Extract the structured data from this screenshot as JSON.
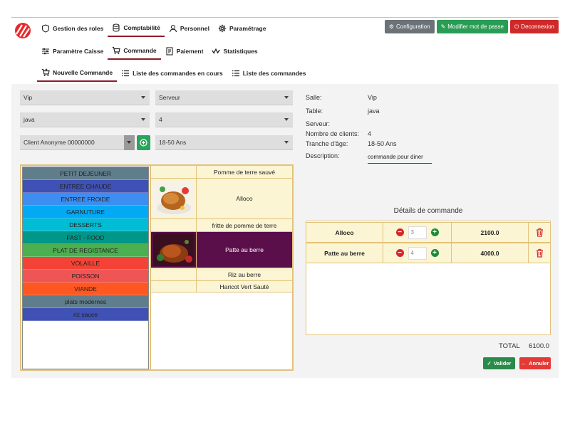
{
  "nav": {
    "main": [
      {
        "label": "Gestion des roles",
        "icon": "shield-icon"
      },
      {
        "label": "Comptabilité",
        "icon": "database-icon"
      },
      {
        "label": "Personnel",
        "icon": "user-icon"
      },
      {
        "label": "Paramétrage",
        "icon": "gear-icon"
      }
    ],
    "sub": [
      {
        "label": "Paramètre Caisse",
        "icon": "sliders-icon"
      },
      {
        "label": "Commande",
        "icon": "cart-icon"
      },
      {
        "label": "Paiement",
        "icon": "receipt-icon"
      },
      {
        "label": "Statistiques",
        "icon": "chart-line-icon"
      }
    ],
    "orders": [
      {
        "label": "Nouvelle Commande",
        "icon": "cart-plus-icon"
      },
      {
        "label": "Liste des commandes en cours",
        "icon": "list-icon"
      },
      {
        "label": "Liste des commandes",
        "icon": "list-icon"
      }
    ]
  },
  "top_buttons": {
    "config": "Configuration",
    "password": "Modifier mot de passe",
    "logout": "Deconnexion"
  },
  "form": {
    "salle": "Vip",
    "serveur": "Serveur",
    "table": "java",
    "clients": "4",
    "client": "Client Anonyme 00000000",
    "age": "18-50 Ans"
  },
  "categories": [
    {
      "label": "PETIT DEJEUNER",
      "color": "#607d8b"
    },
    {
      "label": "ENTREE CHAUDE",
      "color": "#3f51b5"
    },
    {
      "label": "ENTREE FROIDE",
      "color": "#3d8ef0"
    },
    {
      "label": "GARNUTURE",
      "color": "#03a9f4"
    },
    {
      "label": "DESSERTS",
      "color": "#00bcd4"
    },
    {
      "label": "FAST - FOOD",
      "color": "#009688"
    },
    {
      "label": "PLAT DE REGISTANCE",
      "color": "#4caf50"
    },
    {
      "label": "VOLAILLE",
      "color": "#f44336"
    },
    {
      "label": "POISSON",
      "color": "#f05555"
    },
    {
      "label": "VIANDE",
      "color": "#ff5722"
    },
    {
      "label": "plats modernes",
      "color": "#607d8b"
    },
    {
      "label": "riz sauce",
      "color": "#3f51b5"
    }
  ],
  "products": [
    {
      "name": "Pomme de terre sauvé"
    },
    {
      "name": "Alloco"
    },
    {
      "name": "fritte de pomme de terre"
    },
    {
      "name": "Patte au berre"
    },
    {
      "name": "Riz au berre"
    },
    {
      "name": "Haricot Vert Sauté"
    }
  ],
  "info": {
    "salle_label": "Salle:",
    "salle_value": "Vip",
    "table_label": "Table:",
    "table_value": "java",
    "serveur_label": "Serveur:",
    "clients_label": "Nombre de clients:",
    "clients_value": "4",
    "age_label": "Tranche d'âge:",
    "age_value": "18-50 Ans",
    "desc_label": "Description:",
    "desc_value": "commande pour diner"
  },
  "details": {
    "title": "Détails de commande",
    "rows": [
      {
        "name": "Alloco",
        "qty": "3",
        "price": "2100.0"
      },
      {
        "name": "Patte au berre",
        "qty": "4",
        "price": "4000.0"
      }
    ]
  },
  "total": {
    "label": "TOTAL",
    "value": "6100.0"
  },
  "actions": {
    "validate": "Valider",
    "cancel": "Annuler"
  }
}
